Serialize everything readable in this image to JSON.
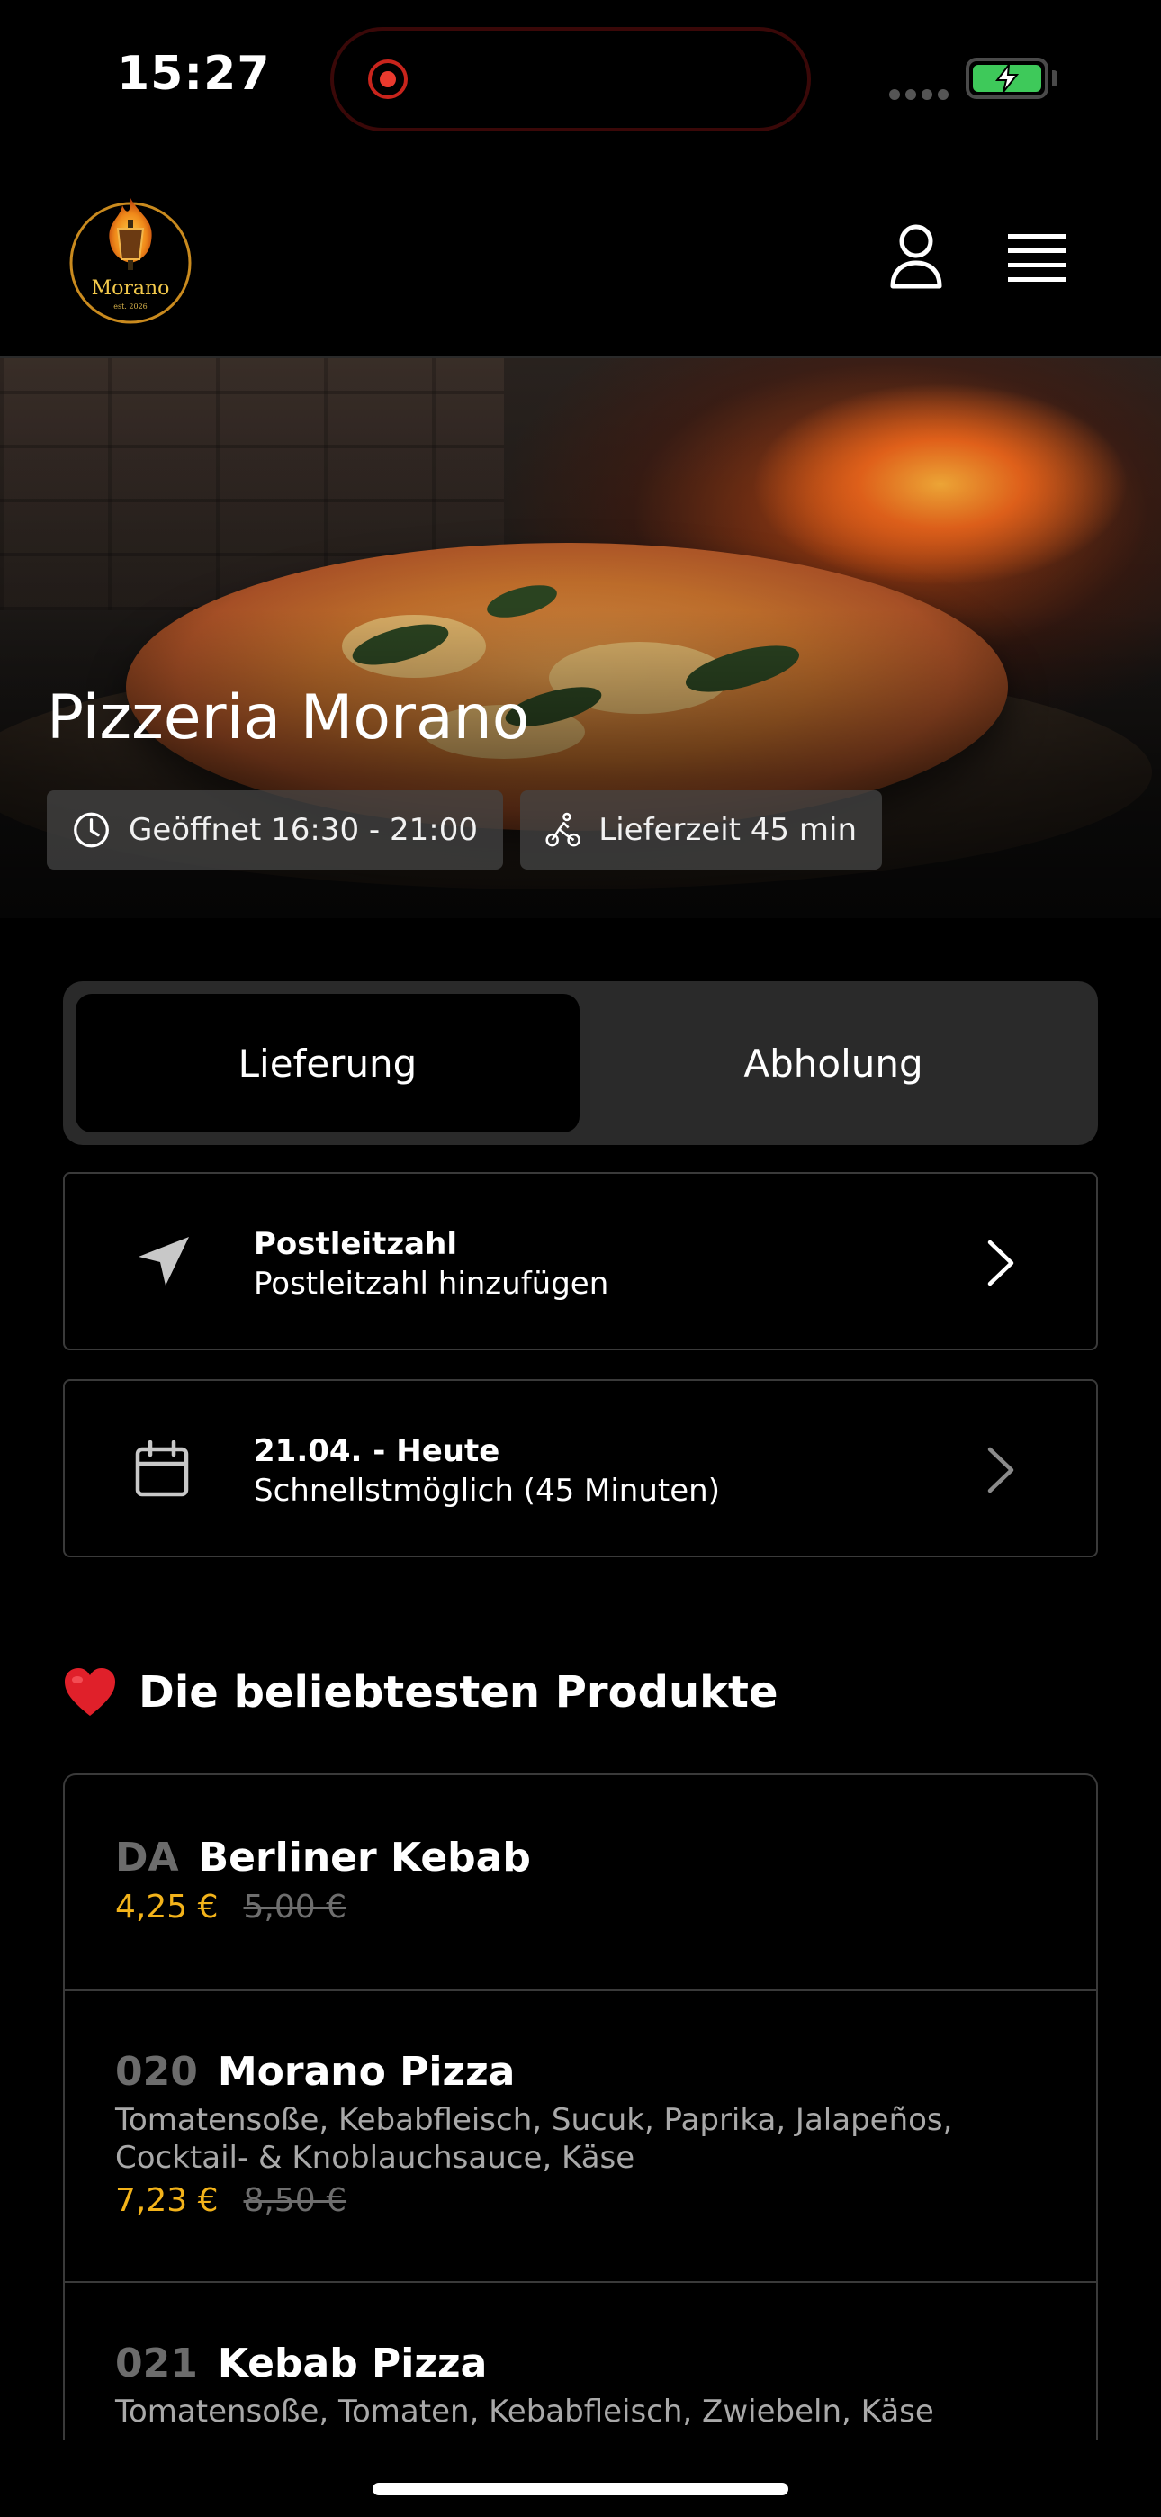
{
  "status_bar": {
    "time": "15:27"
  },
  "header": {
    "logo_text": "Morano",
    "logo_sub": "est. 2026"
  },
  "hero": {
    "title": "Pizzeria Morano",
    "opening_hours": "Geöffnet 16:30 - 21:00",
    "delivery_time": "Lieferzeit 45 min"
  },
  "order_mode": {
    "options": [
      "Lieferung",
      "Abholung"
    ],
    "selected": "Lieferung"
  },
  "postcode_card": {
    "title": "Postleitzahl",
    "subtitle": "Postleitzahl hinzufügen"
  },
  "date_card": {
    "title": "21.04. - Heute",
    "subtitle": "Schnellstmöglich (45 Minuten)"
  },
  "popular": {
    "title": "Die beliebtesten Produkte",
    "products": [
      {
        "number": "DA",
        "name": "Berliner Kebab",
        "description": "",
        "price": "4,25 €",
        "old_price": "5,00 €"
      },
      {
        "number": "020",
        "name": "Morano Pizza",
        "description": "Tomatensoße, Kebabfleisch, Sucuk, Paprika, Jalapeños, Cocktail- & Knoblauchsauce, Käse",
        "price": "7,23 €",
        "old_price": "8,50 €"
      },
      {
        "number": "021",
        "name": "Kebab Pizza",
        "description": "Tomatensoße, Tomaten, Kebabfleisch, Zwiebeln, Käse",
        "price": "",
        "old_price": ""
      }
    ]
  },
  "colors": {
    "accent_price": "#f3b31a",
    "battery": "#3ec95a",
    "background": "#000000"
  }
}
